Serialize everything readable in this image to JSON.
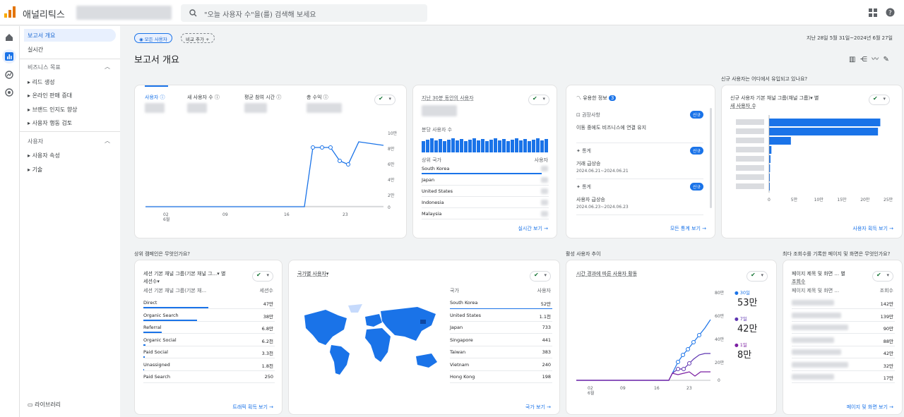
{
  "app": {
    "name": "애널리틱스",
    "search_placeholder": "\"오늘 사용자 수\"을(를) 검색해 보세요"
  },
  "sidebar": {
    "report_home": "보고서 개요",
    "realtime": "실시간",
    "biz_goals": "비즈니스 목표",
    "items": [
      "리드 생성",
      "온라인 판매 증대",
      "브랜드 인지도 향상",
      "사용자 행동 검토"
    ],
    "user": "사용자",
    "user_items": [
      "사용자 속성",
      "기술"
    ],
    "library": "라이브러리"
  },
  "header": {
    "all_users": "모든 사용자",
    "add_compare": "비교 추가",
    "date_range": "지난 28일  5월 31일~2024년 6월 27일",
    "title": "보고서 개요"
  },
  "overview": {
    "tabs": [
      "사용자",
      "새 사용자 수",
      "평균 참여 시간",
      "총 수익"
    ],
    "y_ticks": [
      "10만",
      "8만",
      "6만",
      "4만",
      "2만",
      "0"
    ],
    "x_ticks": [
      "02",
      "09",
      "16",
      "23"
    ],
    "x_month": "6월"
  },
  "realtime": {
    "title": "지난 30분 동안의 사용자",
    "per_min": "분당 사용자 수",
    "col1": "상위 국가",
    "col2": "사용자",
    "countries": [
      "South Korea",
      "Japan",
      "United States",
      "Indonesia",
      "Malaysia"
    ],
    "link": "실시간 보기"
  },
  "insights": {
    "title": "유용한 정보",
    "count": "3",
    "items": [
      {
        "type": "권장사항",
        "text": "이동 중에도 비즈니스에 연결 유지",
        "date": "",
        "badge": "신규"
      },
      {
        "type": "통계",
        "text": "거래 급상승",
        "date": "2024.06.21~2024.06.21",
        "badge": "신규"
      },
      {
        "type": "통계",
        "text": "사용자 급상승",
        "date": "2024.06.23~2024.06.23",
        "badge": "신규"
      }
    ],
    "link": "모든 통계 보기"
  },
  "acq": {
    "question": "신규 사용자는 어디에서 유입되고 있나요?",
    "title": "신규 사용자 기본 채널 그룹(채널 그룹)",
    "metric": "새 사용자 수",
    "x_ticks": [
      "0",
      "5만",
      "10만",
      "15만",
      "20만",
      "25만"
    ],
    "link": "사용자 획득 보기"
  },
  "campaigns": {
    "question": "상위 캠페인은 무엇인가요?",
    "title": "세션 기본 채널 그룹(기본 채널 그...",
    "metric": "세션수",
    "col1": "세션 기본 채널 그룹(기본 채...",
    "col2": "세션수",
    "rows": [
      {
        "name": "Direct",
        "val": "47만"
      },
      {
        "name": "Organic Search",
        "val": "38만"
      },
      {
        "name": "Referral",
        "val": "6.8만"
      },
      {
        "name": "Organic Social",
        "val": "6.2천"
      },
      {
        "name": "Paid Social",
        "val": "3.3천"
      },
      {
        "name": "Unassigned",
        "val": "1.8천"
      },
      {
        "name": "Paid Search",
        "val": "250"
      }
    ],
    "link": "트래픽 획득 보기"
  },
  "country": {
    "title": "국가별 사용자",
    "col1": "국가",
    "col2": "사용자",
    "rows": [
      {
        "name": "South Korea",
        "val": "52만"
      },
      {
        "name": "United States",
        "val": "1.1천"
      },
      {
        "name": "Japan",
        "val": "733"
      },
      {
        "name": "Singapore",
        "val": "441"
      },
      {
        "name": "Taiwan",
        "val": "383"
      },
      {
        "name": "Vietnam",
        "val": "240"
      },
      {
        "name": "Hong Kong",
        "val": "198"
      }
    ],
    "link": "국가 보기"
  },
  "active": {
    "question": "활성 사용자 추이",
    "title": "시간 경과에 따른 사용자 활동",
    "y_ticks": [
      "80만",
      "60만",
      "40만",
      "20만",
      "0"
    ],
    "x_ticks": [
      "02",
      "09",
      "16",
      "23"
    ],
    "x_month": "6월",
    "legend": [
      {
        "label": "30일",
        "val": "53만",
        "color": "#1a73e8"
      },
      {
        "label": "7일",
        "val": "42만",
        "color": "#5e35b1"
      },
      {
        "label": "1일",
        "val": "8만",
        "color": "#7b1fa2"
      }
    ]
  },
  "pages": {
    "question": "최다 조회수를 기록한 페이지 및 화면은 무엇인가요?",
    "title": "페이지 제목 및 화면 ...",
    "metric": "조회수",
    "col1": "페이지 제목 및 화면 ...",
    "col2": "조회수",
    "vals": [
      "142만",
      "139만",
      "90만",
      "88만",
      "42만",
      "32만",
      "17만"
    ],
    "link": "페이지 및 화면 보기"
  }
}
